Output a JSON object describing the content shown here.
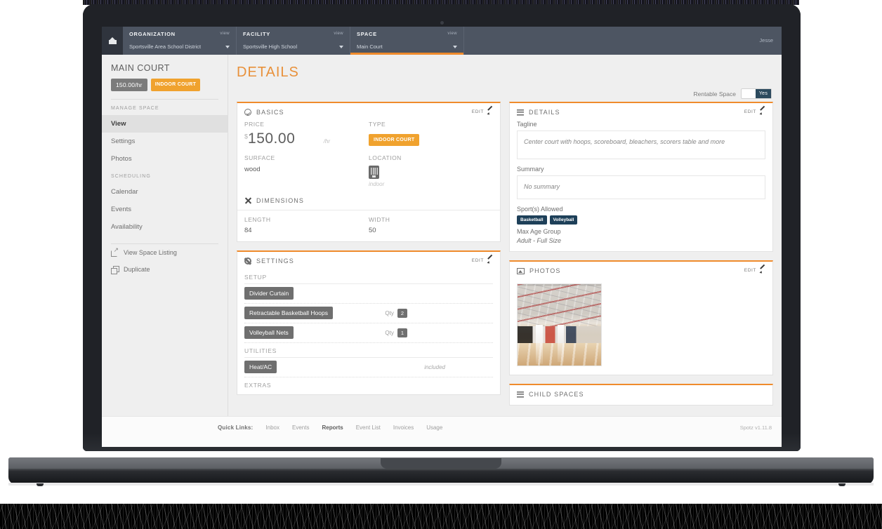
{
  "nav": {
    "home_icon": "home-icon",
    "crumbs": [
      {
        "label": "ORGANIZATION",
        "view": "view",
        "value": "Sportsville Area School District",
        "active": false
      },
      {
        "label": "FACILITY",
        "view": "view",
        "value": "Sportsville High School",
        "active": false
      },
      {
        "label": "SPACE",
        "view": "view",
        "value": "Main Court",
        "active": true
      }
    ],
    "user": "Jesse"
  },
  "sidebar": {
    "title": "MAIN COURT",
    "price_badge": "150.00/hr",
    "type_badge": "INDOOR COURT",
    "manage_header": "MANAGE SPACE",
    "manage_items": [
      {
        "label": "View",
        "active": true
      },
      {
        "label": "Settings",
        "active": false
      },
      {
        "label": "Photos",
        "active": false
      }
    ],
    "scheduling_header": "SCHEDULING",
    "scheduling_items": [
      {
        "label": "Calendar"
      },
      {
        "label": "Events"
      },
      {
        "label": "Availability"
      }
    ],
    "links": [
      {
        "label": "View Space Listing",
        "icon": "external-link-icon"
      },
      {
        "label": "Duplicate",
        "icon": "duplicate-icon"
      }
    ]
  },
  "main": {
    "page_title": "DETAILS",
    "rentable": {
      "label": "Rentable Space",
      "value": "Yes"
    },
    "basics": {
      "heading": "BASICS",
      "edit": "EDIT",
      "price_label": "PRICE",
      "currency": "$",
      "price": "150.00",
      "price_unit": "/hr",
      "type_label": "TYPE",
      "type_value": "INDOOR COURT",
      "surface_label": "SURFACE",
      "surface_value": "wood",
      "location_label": "LOCATION",
      "location_value": "indoor",
      "dimensions_heading": "DIMENSIONS",
      "length_label": "LENGTH",
      "length_value": "84",
      "width_label": "WIDTH",
      "width_value": "50"
    },
    "settings": {
      "heading": "SETTINGS",
      "edit": "EDIT",
      "setup_label": "SETUP",
      "setup_rows": [
        {
          "name": "Divider Curtain",
          "qty_label": "",
          "qty": ""
        },
        {
          "name": "Retractable Basketball Hoops",
          "qty_label": "Qty",
          "qty": "2"
        },
        {
          "name": "Volleyball Nets",
          "qty_label": "Qty",
          "qty": "1"
        }
      ],
      "utilities_label": "UTILITIES",
      "utilities_rows": [
        {
          "name": "Heat/AC",
          "note": "included"
        }
      ],
      "extras_label": "EXTRAS"
    },
    "details": {
      "heading": "DETAILS",
      "edit": "EDIT",
      "tagline_label": "Tagline",
      "tagline_value": "Center court with hoops, scoreboard, bleachers, scorers table and more",
      "summary_label": "Summary",
      "summary_value": "No summary",
      "sports_label": "Sport(s) Allowed",
      "sports": [
        "Basketball",
        "Volleyball"
      ],
      "max_age_label": "Max Age Group",
      "max_age_value": "Adult - Full Size"
    },
    "photos": {
      "heading": "PHOTOS",
      "edit": "EDIT",
      "thumb_alt": "gymnasium-photo"
    },
    "child_spaces": {
      "heading": "CHILD SPACES"
    }
  },
  "footer": {
    "quick_links_label": "Quick Links:",
    "links": [
      {
        "label": "Inbox",
        "strong": false
      },
      {
        "label": "Events",
        "strong": false
      },
      {
        "label": "Reports",
        "strong": true
      },
      {
        "label": "Event List",
        "strong": false
      },
      {
        "label": "Invoices",
        "strong": false
      },
      {
        "label": "Usage",
        "strong": false
      }
    ],
    "version": "Spotz v1.11.8"
  },
  "colors": {
    "accent": "#ef8b2c",
    "nav_bg": "#4d5562",
    "chip_dark": "#1e4059",
    "toggle_on": "#2c4a5e"
  }
}
